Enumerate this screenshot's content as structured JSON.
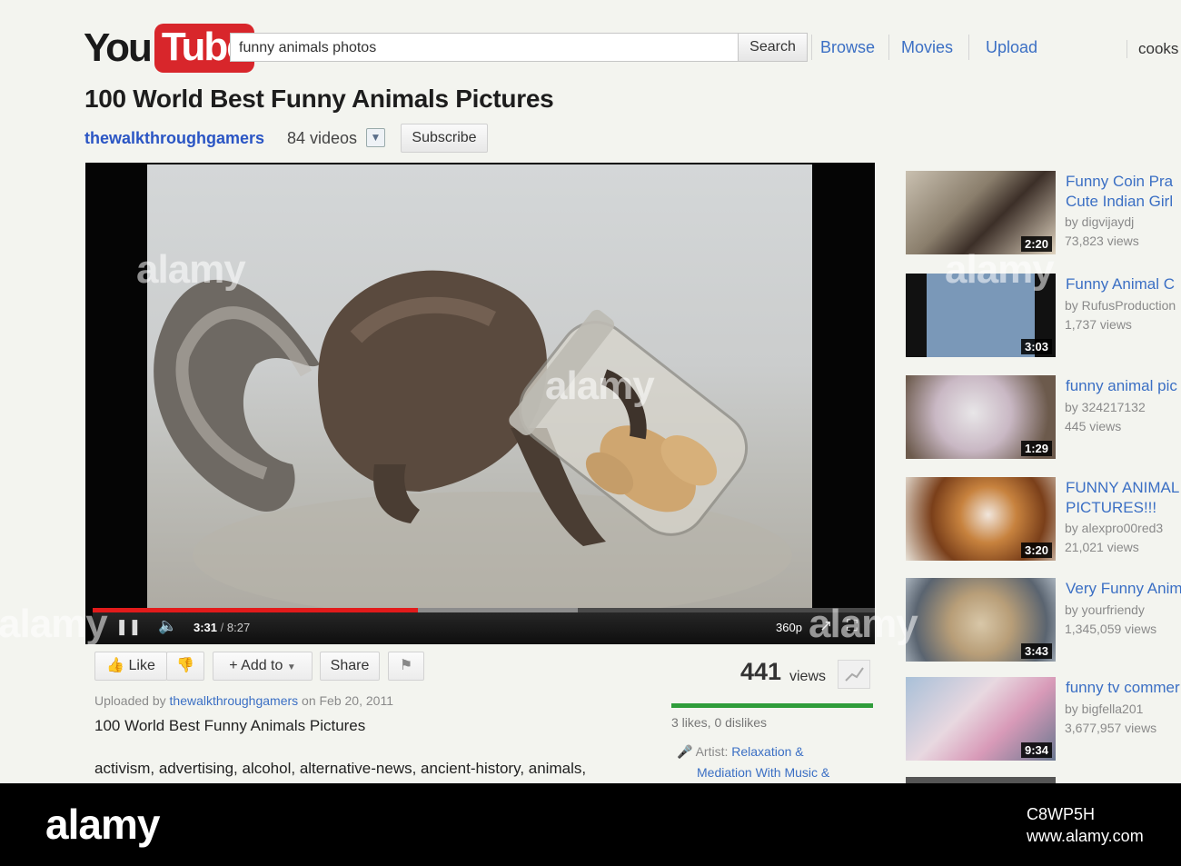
{
  "header": {
    "logo_you": "You",
    "logo_tube": "Tube",
    "search_query": "funny animals photos",
    "search_button": "Search",
    "nav": [
      "Browse",
      "Movies",
      "Upload"
    ],
    "user": "cooks"
  },
  "video": {
    "title": "100 World Best Funny Animals Pictures",
    "channel": "thewalkthroughgamers",
    "channel_videos": "84 videos",
    "subscribe_label": "Subscribe",
    "current_time": "3:31",
    "duration": "8:27",
    "progress_fraction": 0.416,
    "loaded_fraction": 0.62,
    "quality": "360p"
  },
  "actions": {
    "like_label": "Like",
    "add_to_label": "Add to",
    "share_label": "Share",
    "views_count": "441",
    "views_label": "views",
    "likes_text": "3 likes, 0 dislikes",
    "like_ratio": 1.0
  },
  "description": {
    "uploaded_prefix": "Uploaded by",
    "uploader": "thewalkthroughgamers",
    "uploaded_on": "on Feb 20, 2011",
    "title": "100 World Best Funny Animals Pictures",
    "tags": "activism, advertising, alcohol, alternative-news, ancient-history, animals,",
    "artist_label": "Artist:",
    "artist_line1": "Relaxation &",
    "artist_line2": "Mediation With Music &"
  },
  "related": [
    {
      "title1": "Funny Coin Pra",
      "title2": "Cute Indian Girl",
      "by": "by digvijaydj",
      "views": "73,823 views",
      "duration": "2:20"
    },
    {
      "title1": "Funny Animal C",
      "title2": "",
      "by": "by RufusProduction",
      "views": "1,737 views",
      "duration": "3:03"
    },
    {
      "title1": "funny animal pic",
      "title2": "",
      "by": "by 324217132",
      "views": "445 views",
      "duration": "1:29"
    },
    {
      "title1": "FUNNY ANIMAL",
      "title2": "PICTURES!!!",
      "by": "by alexpro00red3",
      "views": "21,021 views",
      "duration": "3:20"
    },
    {
      "title1": "Very Funny Anim",
      "title2": "",
      "by": "by yourfriendy",
      "views": "1,345,059 views",
      "duration": "3:43"
    },
    {
      "title1": "funny tv commer",
      "title2": "",
      "by": "by bigfella201",
      "views": "3,677,957 views",
      "duration": "9:34"
    }
  ],
  "watermark": {
    "brand": "alamy",
    "image_id": "C8WP5H",
    "url": "www.alamy.com"
  },
  "colors": {
    "accent_red": "#d8262b",
    "link_blue": "#3b6fc4",
    "like_green": "#2f9d3b",
    "progress_red": "#e21b1b"
  }
}
